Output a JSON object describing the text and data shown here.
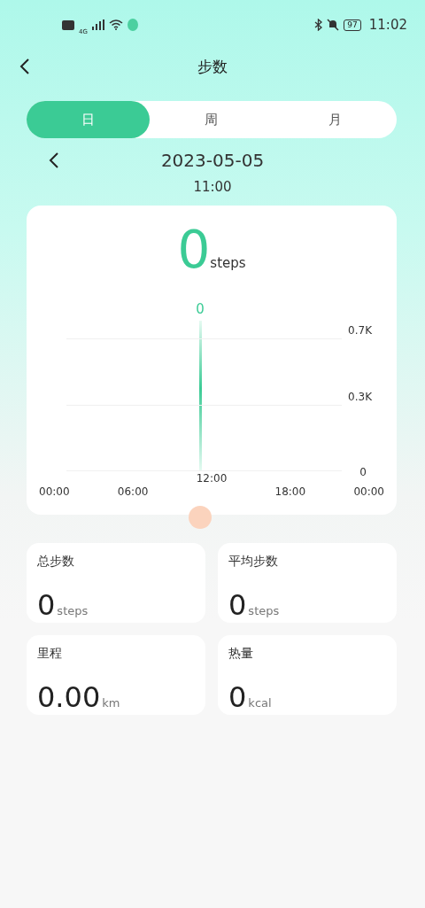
{
  "status_bar": {
    "battery": "97",
    "time": "11:02",
    "network": "4G"
  },
  "header": {
    "title": "步数"
  },
  "tabs": [
    {
      "label": "日",
      "selected": true
    },
    {
      "label": "周",
      "selected": false
    },
    {
      "label": "月",
      "selected": false
    }
  ],
  "date": "2023-05-05",
  "time": "11:00",
  "summary": {
    "value": "0",
    "unit": "steps"
  },
  "chart": {
    "peak_label": "0",
    "y_labels": [
      "0.7K",
      "0.3K",
      "0"
    ],
    "x_labels": [
      {
        "label": "00:00",
        "selected": false
      },
      {
        "label": "06:00",
        "selected": false
      },
      {
        "label": "12:00",
        "selected": true
      },
      {
        "label": "18:00",
        "selected": false
      },
      {
        "label": "00:00",
        "selected": false
      }
    ]
  },
  "stats": [
    {
      "label": "总步数",
      "value": "0",
      "unit": "steps"
    },
    {
      "label": "平均步数",
      "value": "0",
      "unit": "steps"
    },
    {
      "label": "里程",
      "value": "0.00",
      "unit": "km"
    },
    {
      "label": "热量",
      "value": "0",
      "unit": "kcal"
    }
  ]
}
